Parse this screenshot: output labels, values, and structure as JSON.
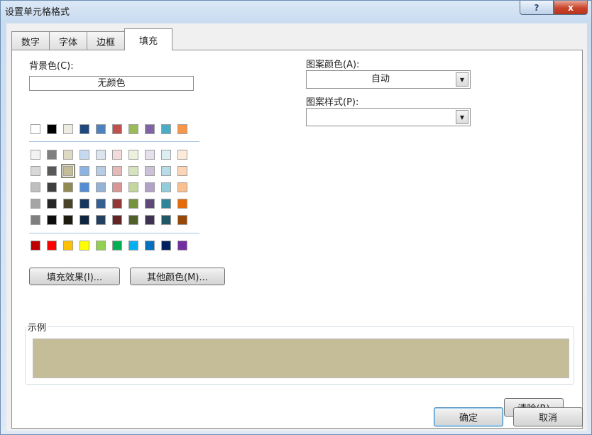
{
  "window": {
    "title": "设置单元格格式",
    "help_label": "?",
    "close_label": "x"
  },
  "tabs": [
    {
      "label": "数字",
      "active": false
    },
    {
      "label": "字体",
      "active": false
    },
    {
      "label": "边框",
      "active": false
    },
    {
      "label": "填充",
      "active": true
    }
  ],
  "fill": {
    "background_label": "背景色(C):",
    "no_color_label": "无颜色",
    "theme_top_row": [
      "#ffffff",
      "#000000",
      "#eeece1",
      "#1f497d",
      "#4f81bd",
      "#c0504d",
      "#9bbb59",
      "#8064a2",
      "#4bacc6",
      "#f79646"
    ],
    "theme_shades": [
      [
        "#f2f2f2",
        "#7f7f7f",
        "#ddd9c3",
        "#c6d9f0",
        "#dbe5f1",
        "#f2dcdb",
        "#ebf1dd",
        "#e5e0ec",
        "#dbeef3",
        "#fdeada"
      ],
      [
        "#d8d8d8",
        "#595959",
        "#c4bd97",
        "#8db3e2",
        "#b8cce4",
        "#e5b9b7",
        "#d7e3bc",
        "#ccc1d9",
        "#b7dde8",
        "#fbd5b5"
      ],
      [
        "#bfbfbf",
        "#3f3f3f",
        "#938953",
        "#548dd4",
        "#95b3d7",
        "#d99694",
        "#c3d69b",
        "#b2a2c7",
        "#92cddc",
        "#fac08f"
      ],
      [
        "#a5a5a5",
        "#262626",
        "#494429",
        "#17365d",
        "#366092",
        "#953734",
        "#76923c",
        "#5f497a",
        "#31859b",
        "#e36c09"
      ],
      [
        "#7f7f7f",
        "#0c0c0c",
        "#1d1b10",
        "#0f243e",
        "#244061",
        "#632423",
        "#4f6128",
        "#3f3151",
        "#205867",
        "#974806"
      ]
    ],
    "standard_colors": [
      "#c00000",
      "#ff0000",
      "#ffc000",
      "#ffff00",
      "#92d050",
      "#00b050",
      "#00b0f0",
      "#0070c0",
      "#002060",
      "#7030a0"
    ],
    "selected_color": "#c4bd97",
    "fill_effects_button": "填充效果(I)...",
    "more_colors_button": "其他颜色(M)...",
    "pattern_color_label": "图案颜色(A):",
    "pattern_color_value": "自动",
    "pattern_style_label": "图案样式(P):",
    "pattern_style_value": "",
    "sample_label": "示例",
    "clear_button": "清除(R)"
  },
  "footer": {
    "ok_button": "确定",
    "cancel_button": "取消"
  }
}
